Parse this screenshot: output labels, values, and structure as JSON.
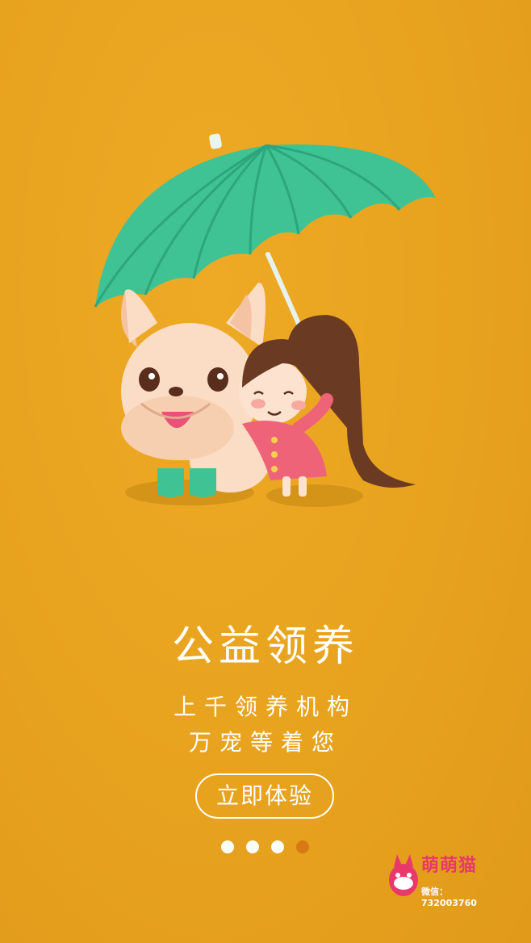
{
  "screen": {
    "title": "公益领养",
    "subtitle_line1": "上千领养机构",
    "subtitle_line2": "万宠等着您",
    "cta_label": "立即体验"
  },
  "pager": {
    "total": 4,
    "active_index": 3
  },
  "brand": {
    "name": "萌萌猫",
    "wechat": "微信：732003760"
  },
  "colors": {
    "background": "#e9a41f",
    "umbrella": "#3fc394",
    "dot_active": "#d67a12",
    "brand": "#e8396a"
  },
  "icons": [
    "umbrella-icon",
    "dog-illustration",
    "girl-illustration",
    "cat-mascot-icon"
  ]
}
